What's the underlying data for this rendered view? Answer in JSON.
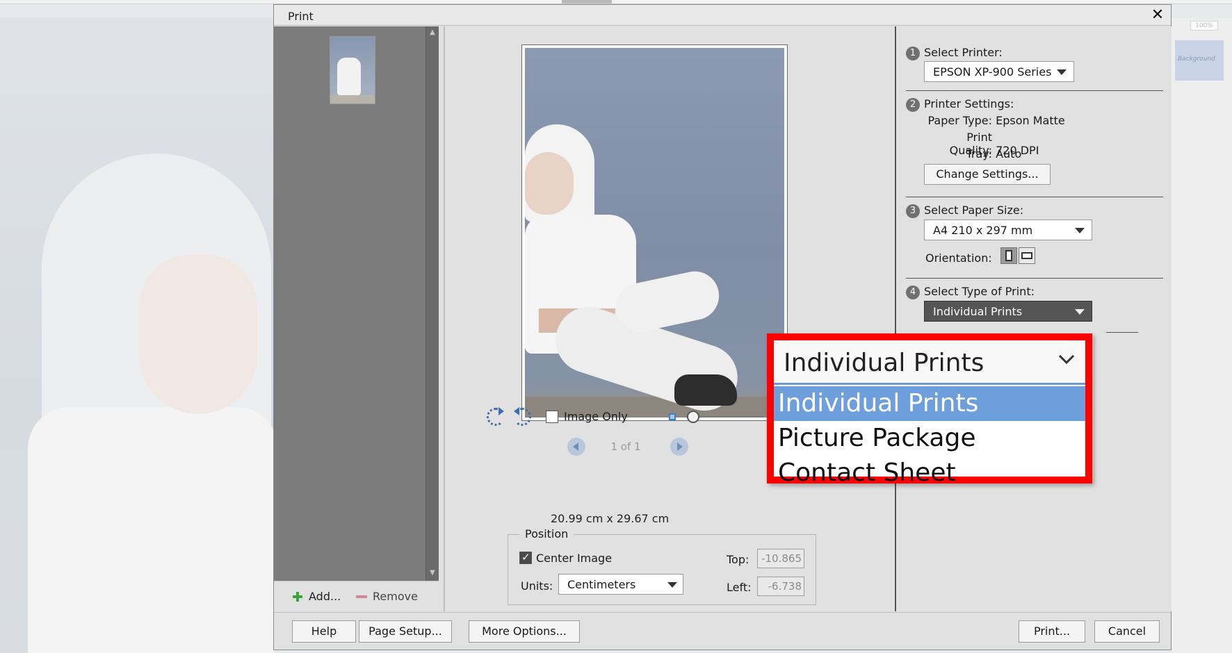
{
  "dialog": {
    "title": "Print"
  },
  "thumbnails": {
    "add_label": "Add...",
    "remove_label": "Remove"
  },
  "preview": {
    "image_only_label": "Image Only",
    "page_count": "1 of 1",
    "dimensions": "20.99 cm x 29.67 cm"
  },
  "position": {
    "legend": "Position",
    "center_image_label": "Center Image",
    "center_image_checked": true,
    "units_label": "Units:",
    "units_value": "Centimeters",
    "top_label": "Top:",
    "top_value": "-10.865",
    "left_label": "Left:",
    "left_value": "-6.738"
  },
  "settings": {
    "step1": {
      "num": "1",
      "label": "Select Printer:",
      "value": "EPSON XP-900 Series"
    },
    "step2": {
      "num": "2",
      "label": "Printer Settings:",
      "paper_type_key": "Paper Type:",
      "paper_type_value": "Epson Matte",
      "print_quality_key": "Print Quality:",
      "print_quality_value": "720 DPI",
      "tray_key": "Tray:",
      "tray_value": "Auto",
      "change_button": "Change Settings..."
    },
    "step3": {
      "num": "3",
      "label": "Select Paper Size:",
      "value": "A4 210 x 297 mm",
      "orientation_label": "Orientation:"
    },
    "step4": {
      "num": "4",
      "label": "Select Type of Print:",
      "value": "Individual Prints"
    }
  },
  "dropdown": {
    "selected": "Individual Prints",
    "options": [
      "Individual Prints",
      "Picture Package",
      "Contact Sheet"
    ]
  },
  "footer": {
    "help": "Help",
    "page_setup": "Page Setup...",
    "more_options": "More Options...",
    "print": "Print...",
    "cancel": "Cancel"
  },
  "background_app": {
    "zoom": "100%",
    "panel_text": "Background"
  },
  "colors": {
    "highlight_border": "#ff0000",
    "selected_option": "#6d9fdc",
    "accent_blue": "#3d6fb4"
  }
}
